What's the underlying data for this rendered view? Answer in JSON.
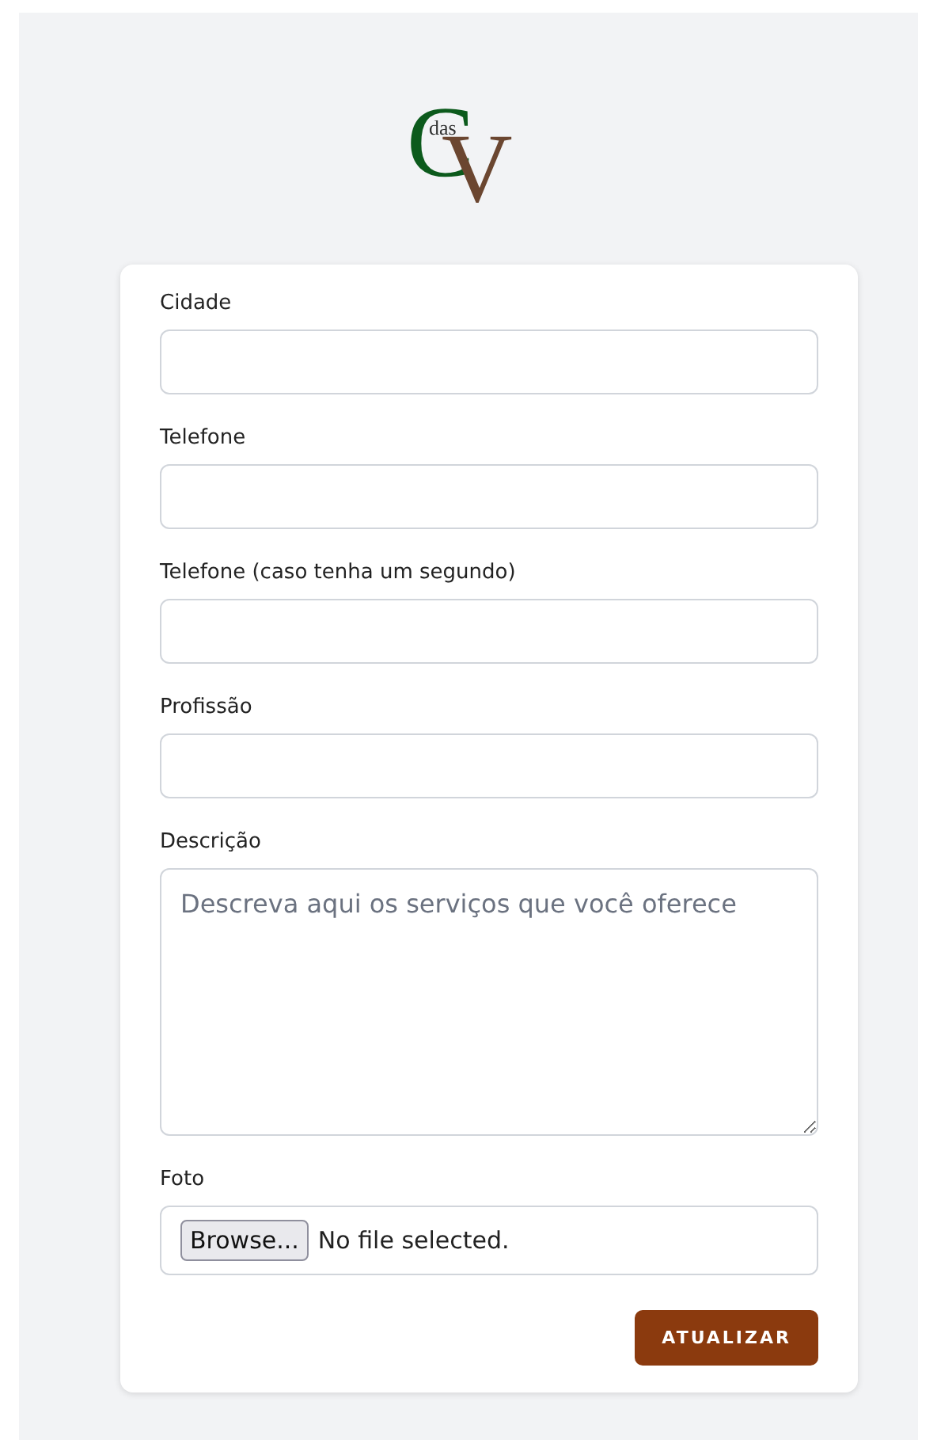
{
  "logo": {
    "letter_1": "C",
    "small": "das",
    "letter_2": "V"
  },
  "fields": [
    {
      "kind": "input",
      "label": "Cidade"
    },
    {
      "kind": "input",
      "label": "Telefone"
    },
    {
      "kind": "input",
      "label": "Telefone (caso tenha um segundo)"
    },
    {
      "kind": "input",
      "label": "Profissão"
    },
    {
      "kind": "textarea",
      "label": "Descrição",
      "placeholder": "Descreva aqui os serviços que você oferece"
    },
    {
      "kind": "file",
      "label": "Foto",
      "button": "Browse...",
      "status": "No file selected."
    }
  ],
  "submit": "ATUALIZAR"
}
